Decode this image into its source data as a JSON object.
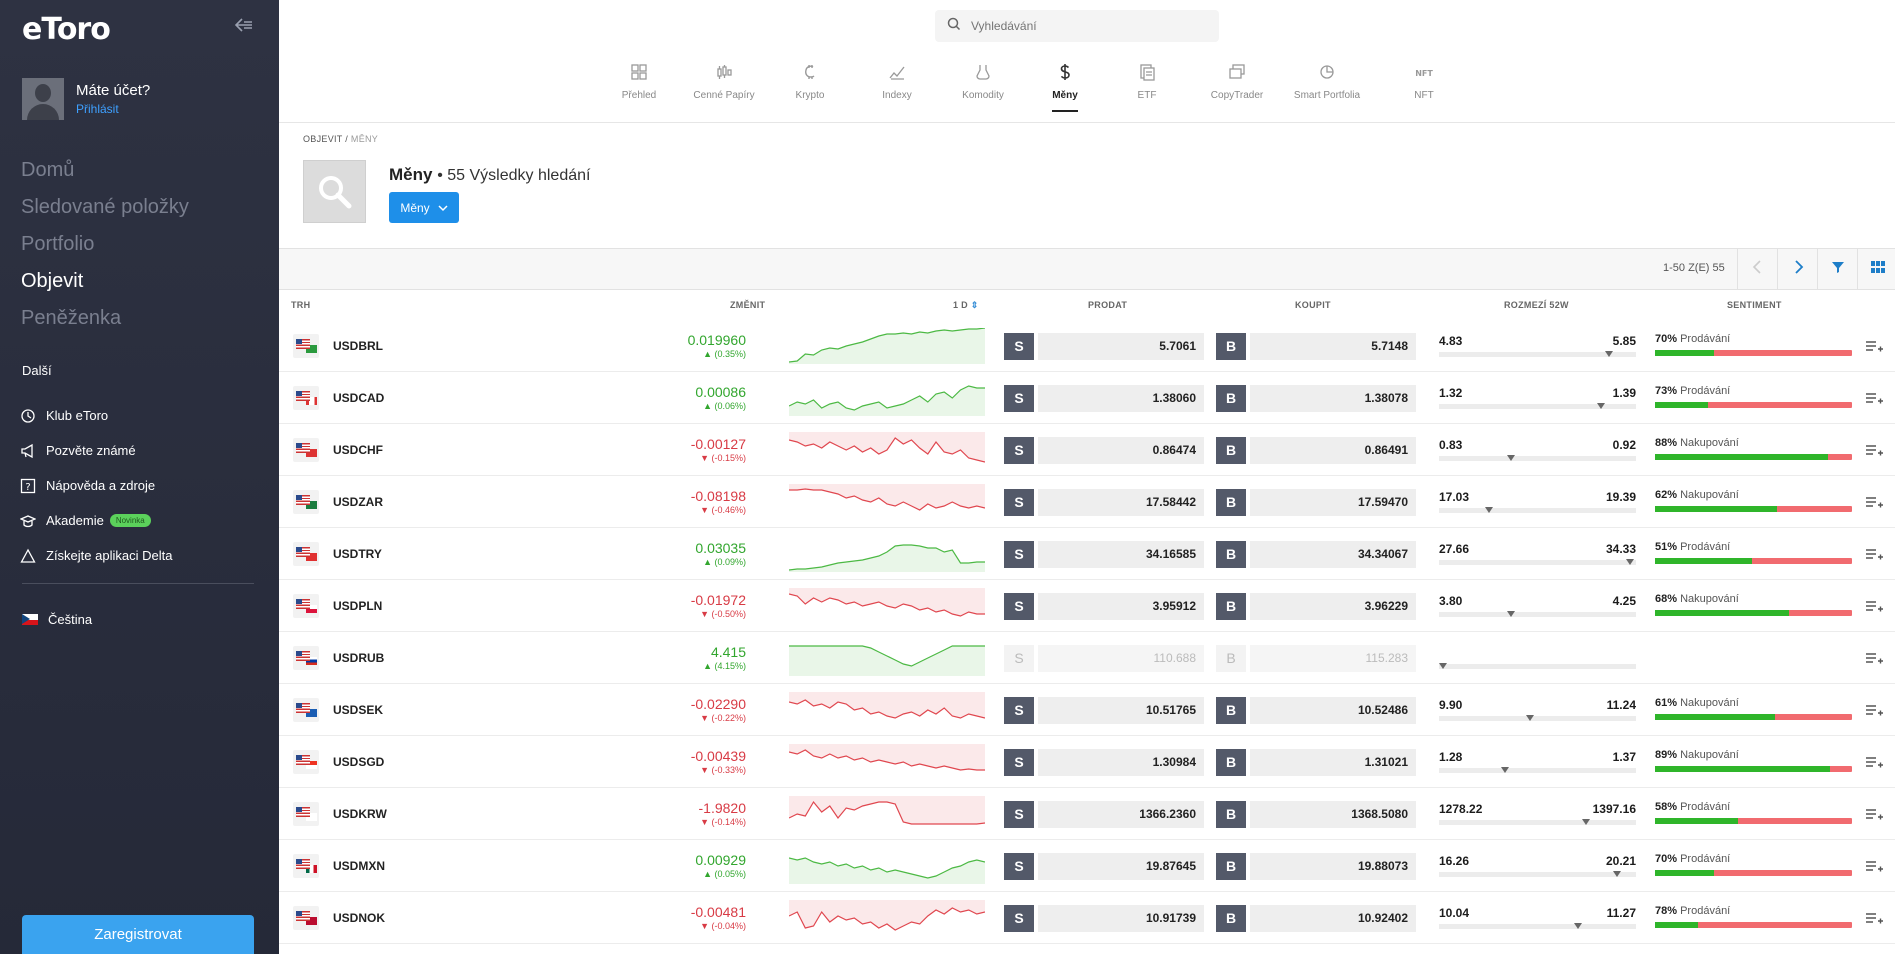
{
  "sidebar": {
    "logo": "eToro",
    "user": {
      "name": "Máte účet?",
      "login": "Přihlásit"
    },
    "nav": [
      {
        "label": "Domů",
        "active": false
      },
      {
        "label": "Sledované položky",
        "active": false
      },
      {
        "label": "Portfolio",
        "active": false
      },
      {
        "label": "Objevit",
        "active": true
      },
      {
        "label": "Peněženka",
        "active": false
      }
    ],
    "more_title": "Další",
    "more": [
      {
        "label": "Klub eToro",
        "icon": "club-icon"
      },
      {
        "label": "Pozvěte známé",
        "icon": "megaphone-icon"
      },
      {
        "label": "Nápověda a zdroje",
        "icon": "help-icon"
      },
      {
        "label": "Akademie",
        "icon": "academy-icon",
        "badge": "Novinka"
      },
      {
        "label": "Získejte aplikaci Delta",
        "icon": "delta-icon"
      }
    ],
    "language": "Čeština",
    "register": "Zaregistrovat"
  },
  "search": {
    "placeholder": "Vyhledávání"
  },
  "categories": [
    {
      "label": "Přehled",
      "icon": "grid-icon"
    },
    {
      "label": "Cenné Papíry",
      "icon": "candles-icon"
    },
    {
      "label": "Krypto",
      "icon": "crypto-icon"
    },
    {
      "label": "Indexy",
      "icon": "index-icon"
    },
    {
      "label": "Komodity",
      "icon": "commodity-icon"
    },
    {
      "label": "Měny",
      "icon": "dollar-icon",
      "active": true
    },
    {
      "label": "ETF",
      "icon": "etf-icon"
    },
    {
      "label": "CopyTrader",
      "icon": "copytrader-icon"
    },
    {
      "label": "Smart Portfolia",
      "icon": "smart-portfolio-icon"
    },
    {
      "label": "NFT",
      "icon": "nft-icon"
    }
  ],
  "breadcrumb": {
    "root": "OBJEVIT",
    "sep": "/",
    "current": "MĚNY"
  },
  "results": {
    "title": "Měny",
    "count": "• 55 Výsledky hledání",
    "filter": "Měny"
  },
  "pager": "1-50 Z(E) 55",
  "columns": {
    "market": "TRH",
    "change": "ZMĚNIT",
    "period": "1 D",
    "sell": "PRODAT",
    "buy": "KOUPIT",
    "range": "ROZMEZÍ 52W",
    "sentiment": "SENTIMENT"
  },
  "rows": [
    {
      "name": "USDBRL",
      "change": "0.019960",
      "pct": "▲ (0.35%)",
      "dir": "pos",
      "sell_label": "S",
      "sell": "5.7061",
      "buy_label": "B",
      "buy": "5.7148",
      "lo": "4.83",
      "hi": "5.85",
      "marker": 0.86,
      "sent_pct": "70%",
      "sent_label": "Prodávání",
      "green": 0.3,
      "spark": [
        2,
        3,
        10,
        9,
        14,
        16,
        15,
        18,
        20,
        22,
        25,
        28,
        30,
        30,
        31,
        30,
        32,
        31,
        33,
        34,
        33,
        34,
        35,
        35,
        36
      ]
    },
    {
      "name": "USDCAD",
      "change": "0.00086",
      "pct": "▲ (0.06%)",
      "dir": "pos",
      "sell_label": "S",
      "sell": "1.38060",
      "buy_label": "B",
      "buy": "1.38078",
      "lo": "1.32",
      "hi": "1.39",
      "marker": 0.82,
      "sent_pct": "73%",
      "sent_label": "Prodávání",
      "green": 0.27,
      "spark": [
        10,
        14,
        12,
        16,
        8,
        12,
        14,
        8,
        6,
        10,
        12,
        14,
        8,
        10,
        12,
        16,
        20,
        14,
        22,
        24,
        18,
        26,
        30,
        28,
        28
      ]
    },
    {
      "name": "USDCHF",
      "change": "-0.00127",
      "pct": "▼ (-0.15%)",
      "dir": "neg",
      "sell_label": "S",
      "sell": "0.86474",
      "buy_label": "B",
      "buy": "0.86491",
      "lo": "0.83",
      "hi": "0.92",
      "marker": 0.35,
      "sent_pct": "88%",
      "sent_label": "Nakupování",
      "green": 0.88,
      "spark": [
        28,
        26,
        22,
        24,
        20,
        26,
        22,
        18,
        22,
        16,
        20,
        14,
        18,
        30,
        24,
        28,
        20,
        14,
        26,
        16,
        14,
        18,
        10,
        8,
        6
      ]
    },
    {
      "name": "USDZAR",
      "change": "-0.08198",
      "pct": "▼ (-0.46%)",
      "dir": "neg",
      "sell_label": "S",
      "sell": "17.58442",
      "buy_label": "B",
      "buy": "17.59470",
      "lo": "17.03",
      "hi": "19.39",
      "marker": 0.24,
      "sent_pct": "62%",
      "sent_label": "Nakupování",
      "green": 0.62,
      "spark": [
        30,
        30,
        31,
        30,
        30,
        28,
        26,
        22,
        24,
        20,
        18,
        22,
        16,
        14,
        18,
        14,
        10,
        16,
        12,
        14,
        18,
        14,
        12,
        14,
        12
      ]
    },
    {
      "name": "USDTRY",
      "change": "0.03035",
      "pct": "▲ (0.09%)",
      "dir": "pos",
      "sell_label": "S",
      "sell": "34.16585",
      "buy_label": "B",
      "buy": "34.34067",
      "lo": "27.66",
      "hi": "34.33",
      "marker": 0.97,
      "sent_pct": "51%",
      "sent_label": "Prodávání",
      "green": 0.49,
      "spark": [
        2,
        3,
        3,
        4,
        5,
        7,
        9,
        10,
        11,
        12,
        14,
        16,
        20,
        26,
        27,
        27,
        26,
        24,
        24,
        20,
        22,
        9,
        9,
        10,
        10
      ]
    },
    {
      "name": "USDPLN",
      "change": "-0.01972",
      "pct": "▼ (-0.50%)",
      "dir": "neg",
      "sell_label": "S",
      "sell": "3.95912",
      "buy_label": "B",
      "buy": "3.96229",
      "lo": "3.80",
      "hi": "4.25",
      "marker": 0.35,
      "sent_pct": "68%",
      "sent_label": "Nakupování",
      "green": 0.68,
      "spark": [
        30,
        28,
        20,
        26,
        22,
        26,
        24,
        20,
        22,
        18,
        20,
        22,
        18,
        16,
        20,
        18,
        14,
        16,
        12,
        14,
        10,
        8,
        12,
        10,
        10
      ]
    },
    {
      "name": "USDRUB",
      "change": "4.415",
      "pct": "▲ (4.15%)",
      "dir": "pos",
      "disabled": true,
      "sell_label": "S",
      "sell": "110.688",
      "buy_label": "B",
      "buy": "115.283",
      "lo": "",
      "hi": "",
      "marker": 0.0,
      "sent_pct": "",
      "sent_label": "",
      "green": 0,
      "spark": [
        30,
        30,
        30,
        30,
        30,
        30,
        30,
        30,
        30,
        30,
        28,
        24,
        20,
        16,
        12,
        10,
        14,
        18,
        22,
        26,
        30,
        30,
        30,
        30,
        30
      ]
    },
    {
      "name": "USDSEK",
      "change": "-0.02290",
      "pct": "▼ (-0.22%)",
      "dir": "neg",
      "sell_label": "S",
      "sell": "10.51765",
      "buy_label": "B",
      "buy": "10.52486",
      "lo": "9.90",
      "hi": "11.24",
      "marker": 0.45,
      "sent_pct": "61%",
      "sent_label": "Nakupování",
      "green": 0.61,
      "spark": [
        26,
        24,
        28,
        22,
        24,
        20,
        26,
        24,
        18,
        20,
        14,
        16,
        12,
        10,
        14,
        16,
        12,
        18,
        14,
        20,
        12,
        10,
        14,
        12,
        10
      ]
    },
    {
      "name": "USDSGD",
      "change": "-0.00439",
      "pct": "▼ (-0.33%)",
      "dir": "neg",
      "sell_label": "S",
      "sell": "1.30984",
      "buy_label": "B",
      "buy": "1.31021",
      "lo": "1.28",
      "hi": "1.37",
      "marker": 0.32,
      "sent_pct": "89%",
      "sent_label": "Nakupování",
      "green": 0.89,
      "spark": [
        28,
        26,
        30,
        24,
        22,
        26,
        22,
        24,
        20,
        22,
        18,
        20,
        18,
        16,
        18,
        14,
        16,
        14,
        12,
        14,
        12,
        10,
        11,
        10,
        10
      ]
    },
    {
      "name": "USDKRW",
      "change": "-1.9820",
      "pct": "▼ (-0.14%)",
      "dir": "neg",
      "sell_label": "S",
      "sell": "1366.2360",
      "buy_label": "B",
      "buy": "1368.5080",
      "lo": "1278.22",
      "hi": "1397.16",
      "marker": 0.74,
      "sent_pct": "58%",
      "sent_label": "Prodávání",
      "green": 0.42,
      "spark": [
        14,
        18,
        16,
        30,
        20,
        26,
        14,
        24,
        22,
        26,
        28,
        30,
        30,
        28,
        10,
        8,
        8,
        8,
        8,
        8,
        8,
        8,
        8,
        8,
        9
      ]
    },
    {
      "name": "USDMXN",
      "change": "0.00929",
      "pct": "▲ (0.05%)",
      "dir": "pos",
      "sell_label": "S",
      "sell": "19.87645",
      "buy_label": "B",
      "buy": "19.88073",
      "lo": "16.26",
      "hi": "20.21",
      "marker": 0.9,
      "sent_pct": "70%",
      "sent_label": "Prodávání",
      "green": 0.3,
      "spark": [
        26,
        24,
        26,
        22,
        20,
        22,
        18,
        20,
        16,
        18,
        14,
        16,
        12,
        14,
        12,
        10,
        8,
        6,
        8,
        12,
        16,
        18,
        22,
        24,
        22
      ]
    },
    {
      "name": "USDNOK",
      "change": "-0.00481",
      "pct": "▼ (-0.04%)",
      "dir": "neg",
      "sell_label": "S",
      "sell": "10.91739",
      "buy_label": "B",
      "buy": "10.92402",
      "lo": "10.04",
      "hi": "11.27",
      "marker": 0.7,
      "sent_pct": "78%",
      "sent_label": "Prodávání",
      "green": 0.22,
      "spark": [
        20,
        24,
        8,
        10,
        24,
        14,
        20,
        16,
        18,
        12,
        14,
        8,
        12,
        6,
        10,
        14,
        12,
        20,
        26,
        22,
        28,
        24,
        26,
        22,
        24
      ]
    }
  ]
}
